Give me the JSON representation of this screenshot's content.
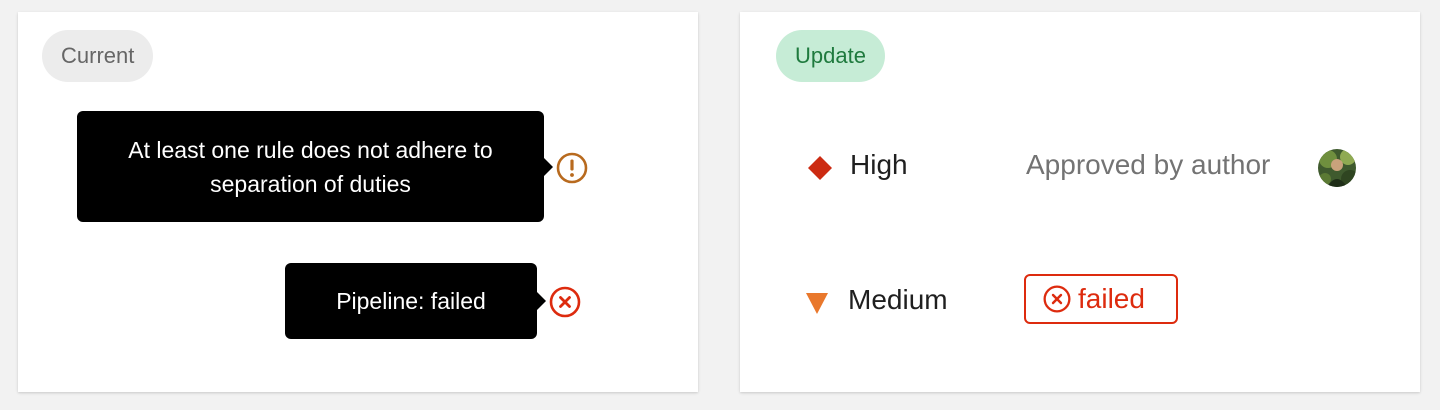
{
  "current": {
    "badge": "Current",
    "tooltip_separation": "At least one rule does not adhere to separation of duties",
    "tooltip_pipeline": "Pipeline: failed",
    "warning_icon": "exclamation-circle-icon",
    "error_icon": "close-circle-icon"
  },
  "update": {
    "badge": "Update",
    "rows": [
      {
        "severity": "High",
        "icon": "diamond-icon",
        "color": "#cc2b12",
        "detail": "Approved by author"
      },
      {
        "severity": "Medium",
        "icon": "triangle-down-icon",
        "color": "#e9782c",
        "detail": "failed"
      }
    ]
  },
  "colors": {
    "warning": "#b86a1e",
    "error": "#dd2b0e",
    "update_badge_bg": "#c6ecd6",
    "update_badge_text": "#1f7a3e",
    "current_badge_bg": "#ececec"
  }
}
